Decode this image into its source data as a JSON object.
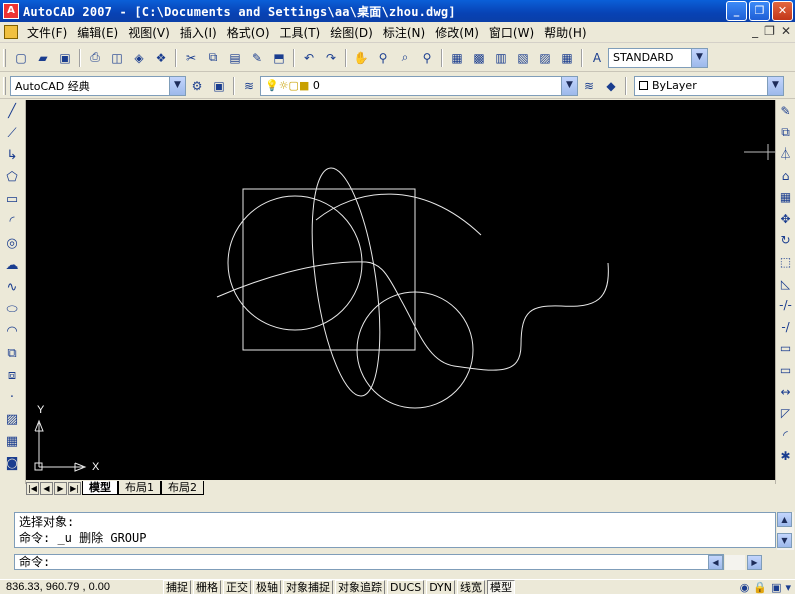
{
  "window": {
    "title": "AutoCAD 2007 - [C:\\Documents and Settings\\aa\\桌面\\zhou.dwg]",
    "app_icon_text": "A",
    "controls": [
      "_",
      "❐",
      "✕"
    ]
  },
  "menu": {
    "items": [
      "文件(F)",
      "编辑(E)",
      "视图(V)",
      "插入(I)",
      "格式(O)",
      "工具(T)",
      "绘图(D)",
      "标注(N)",
      "修改(M)",
      "窗口(W)",
      "帮助(H)"
    ],
    "mdi_controls": [
      "_",
      "❐",
      "✕"
    ]
  },
  "toolbar_standard": {
    "icons": [
      "new-icon",
      "open-icon",
      "save-icon",
      "print-icon",
      "preview-icon",
      "publish-icon",
      "3d-publish-icon",
      "cut-icon",
      "copy-icon",
      "paste-icon",
      "match-properties-icon",
      "block-editor-icon",
      "undo-icon",
      "redo-icon",
      "pan-icon",
      "zoom-realtime-icon",
      "zoom-window-icon",
      "zoom-previous-icon",
      "properties-icon",
      "design-center-icon",
      "tool-palettes-icon",
      "sheet-set-icon",
      "markup-icon",
      "calculator-icon",
      "text-style-icon"
    ],
    "text_style": "STANDARD"
  },
  "toolbar_workspace": {
    "workspace": "AutoCAD 经典",
    "layer": "0",
    "color": "ByLayer"
  },
  "layout_tabs": [
    "模型",
    "布局1",
    "布局2"
  ],
  "command_window": {
    "history": [
      "选择对象:",
      "命令: _u 删除 GROUP"
    ],
    "prompt": "命令:"
  },
  "status": {
    "coordinates": "836.33,  960.79 , 0.00",
    "toggles": [
      {
        "label": "捕捉",
        "on": false
      },
      {
        "label": "栅格",
        "on": false
      },
      {
        "label": "正交",
        "on": false
      },
      {
        "label": "极轴",
        "on": false
      },
      {
        "label": "对象捕捉",
        "on": false
      },
      {
        "label": "对象追踪",
        "on": false
      },
      {
        "label": "DUCS",
        "on": false
      },
      {
        "label": "DYN",
        "on": false
      },
      {
        "label": "线宽",
        "on": false
      },
      {
        "label": "模型",
        "on": true
      }
    ]
  },
  "ucs": {
    "x_label": "X",
    "y_label": "Y"
  },
  "colors": {
    "canvas": "#000000",
    "geometry": "#e8e8e8",
    "titlebar": "#0a5fd8"
  }
}
